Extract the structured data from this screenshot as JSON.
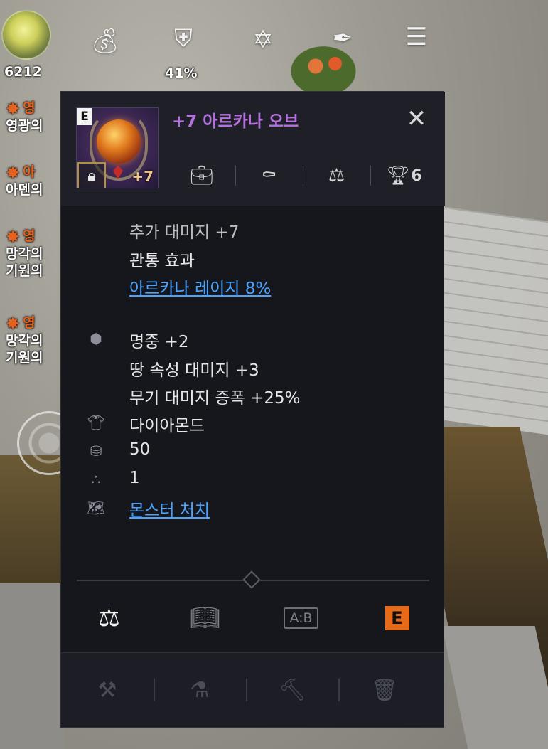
{
  "hud": {
    "currency_value": "6212",
    "percent_value": "41%",
    "icons": [
      "gold-orb-icon",
      "money-bag-icon",
      "shield-quest-icon",
      "book-icon",
      "feather-icon",
      "menu-icon"
    ]
  },
  "quests": [
    {
      "head": "영",
      "line1": "영광의"
    },
    {
      "head": "아",
      "line1": "아덴의"
    },
    {
      "head": "영",
      "line1": "망각의",
      "line2": "기원의"
    },
    {
      "head": "영",
      "line1": "망각의",
      "line2": "기원의"
    }
  ],
  "item": {
    "grade": "E",
    "enhance": "+7",
    "name": "+7 아르카나 오브",
    "header_count": "6",
    "lines": {
      "partial": "추가 대미지 +7",
      "pierce": "관통 효과",
      "skill_link": "아르카나 레이지 8%"
    },
    "stats": [
      {
        "icon": "gem-stat-icon",
        "text": "명중 +2"
      },
      {
        "icon": "",
        "text": "땅 속성 대미지 +3"
      },
      {
        "icon": "",
        "text": "무기 대미지 증폭 +25%"
      }
    ],
    "material": "다이아몬드",
    "weight": "50",
    "stack": "1",
    "source_link": "몬스터 처치"
  },
  "tabs": {
    "e_label": "E",
    "ab_label": "A:B"
  },
  "colors": {
    "item_name": "#b571e0",
    "link": "#4aa3ff",
    "grade_orange": "#e76a1a"
  }
}
